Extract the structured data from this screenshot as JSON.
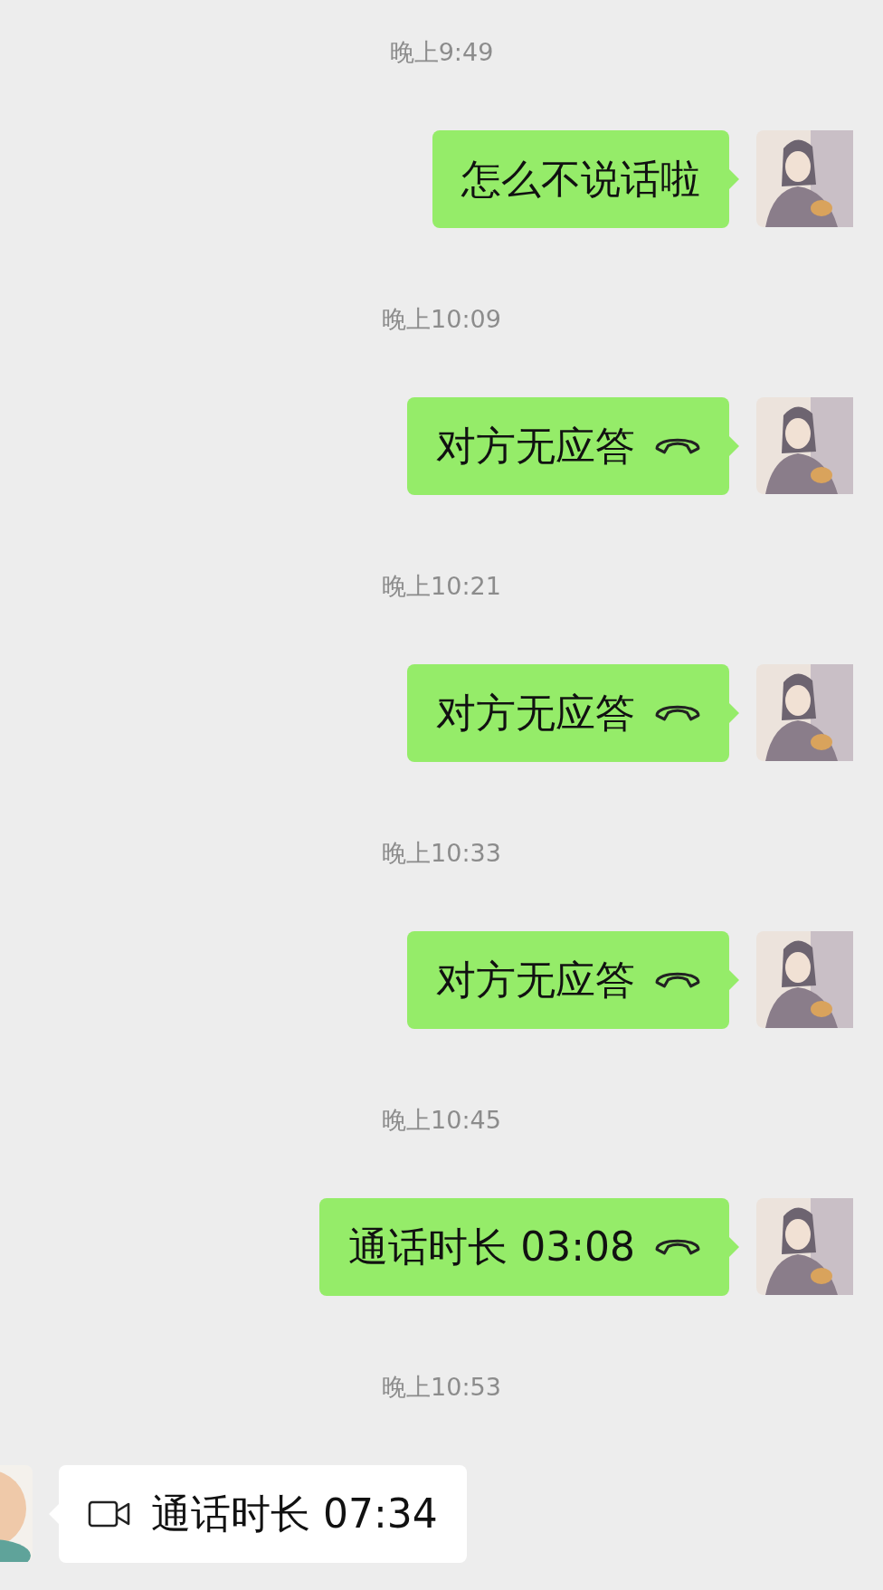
{
  "messages": [
    {
      "time": "晚上9:49",
      "outgoing": true,
      "kind": "text",
      "text": "怎么不说话啦"
    },
    {
      "time": "晚上10:09",
      "outgoing": true,
      "kind": "voice_call",
      "text": "对方无应答"
    },
    {
      "time": "晚上10:21",
      "outgoing": true,
      "kind": "voice_call",
      "text": "对方无应答"
    },
    {
      "time": "晚上10:33",
      "outgoing": true,
      "kind": "voice_call",
      "text": "对方无应答"
    },
    {
      "time": "晚上10:45",
      "outgoing": true,
      "kind": "voice_call",
      "text": "通话时长 03:08"
    },
    {
      "time": "晚上10:53",
      "outgoing": false,
      "kind": "video_call",
      "text": "通话时长 07:34"
    }
  ]
}
